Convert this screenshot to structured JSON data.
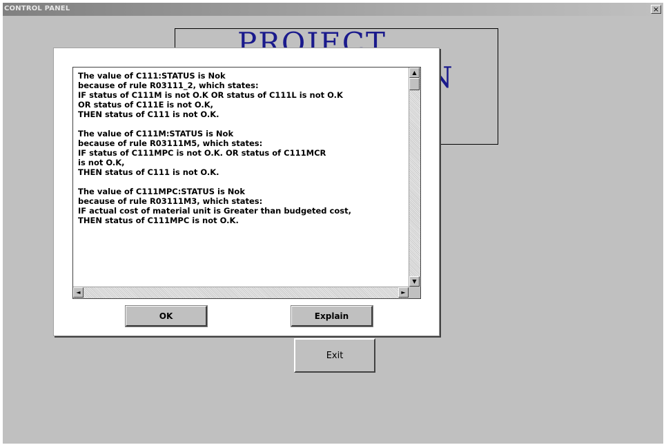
{
  "window": {
    "title": "CONTROL PANEL",
    "close_icon": "×"
  },
  "background": {
    "project_title": "PROJECT",
    "project_subtitle_partial": "N"
  },
  "main": {
    "exit_label": "Exit"
  },
  "dialog": {
    "paragraphs": [
      {
        "lines": [
          "The value of C111:STATUS is Nok",
          "because of rule R03111_2, which states:",
          "IF status of C111M is not O.K OR status of C111L is not O.K",
          "OR status of C111E is not O.K,",
          "THEN status of C111 is not O.K."
        ]
      },
      {
        "lines": [
          "The value of C111M:STATUS is Nok",
          "because of rule R03111M5, which states:",
          "IF status of C111MPC is not O.K. OR status of C111MCR",
          "is not O.K,",
          "THEN status of C111 is not O.K."
        ]
      },
      {
        "lines": [
          "The value of C111MPC:STATUS is Nok",
          "because of rule R03111M3, which states:",
          "IF actual cost of material unit is Greater than budgeted cost,",
          "THEN status of C111MPC is not O.K."
        ]
      }
    ],
    "ok_label": "OK",
    "explain_label": "Explain",
    "scroll_up_icon": "▲",
    "scroll_down_icon": "▼",
    "scroll_left_icon": "◄",
    "scroll_right_icon": "►"
  }
}
